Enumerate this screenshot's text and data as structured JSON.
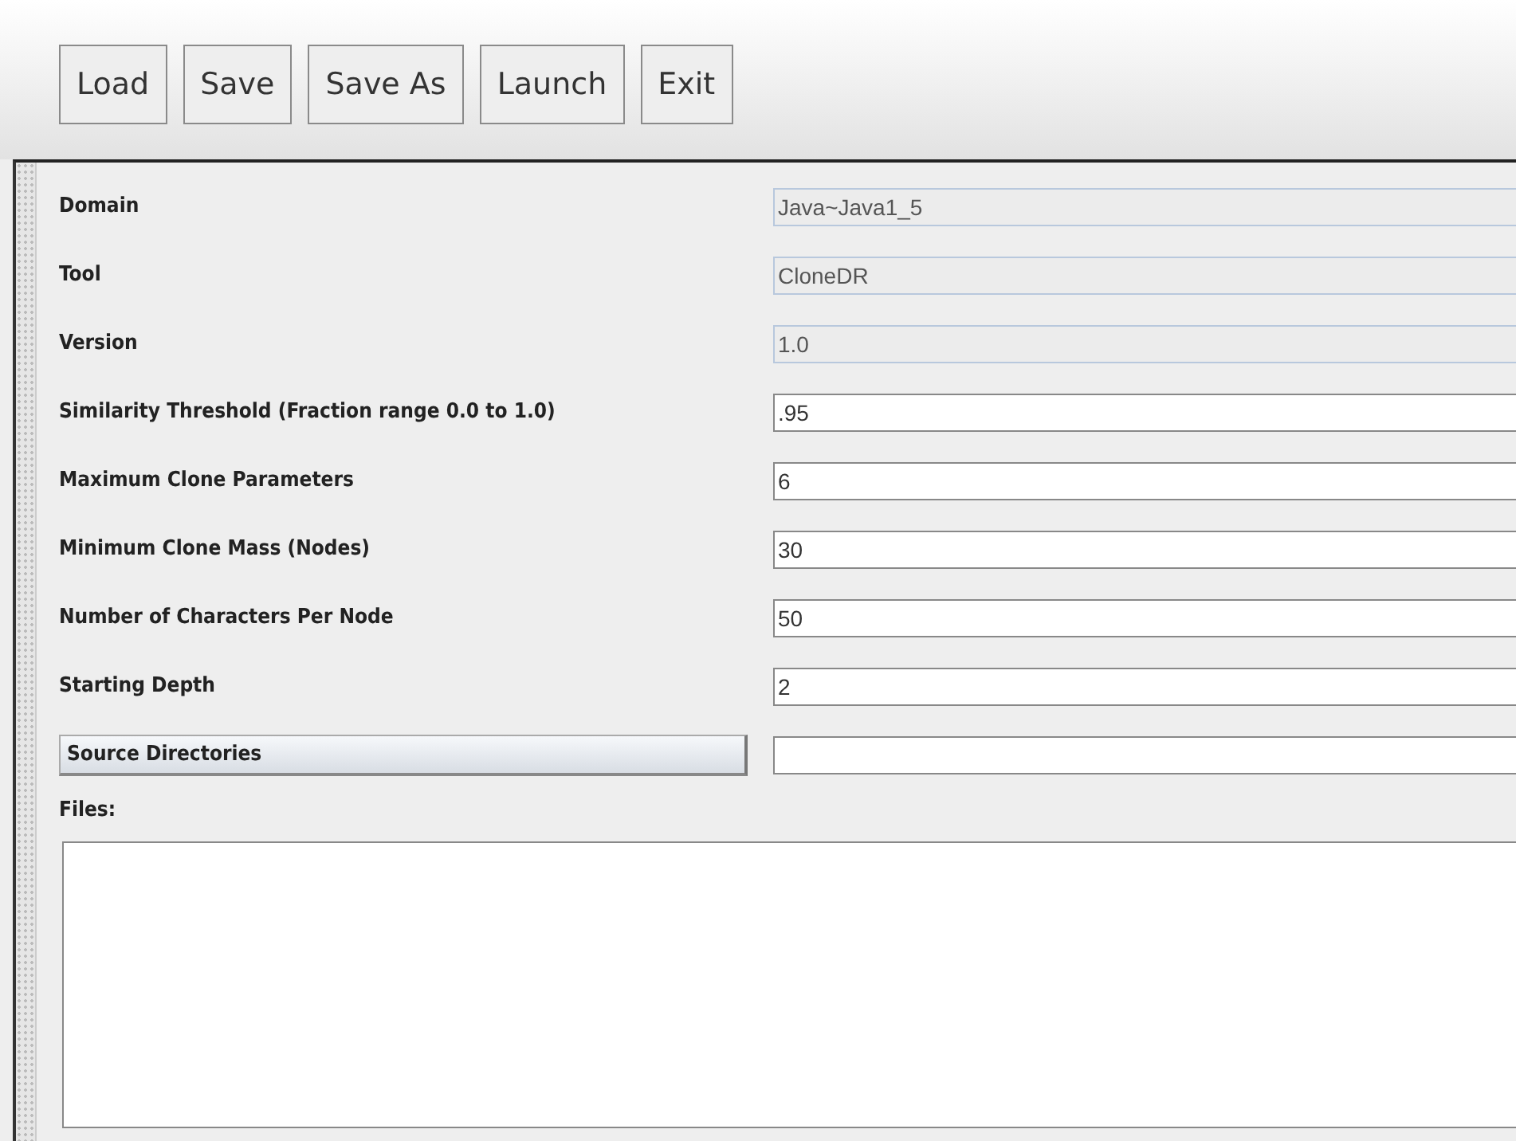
{
  "toolbar": {
    "buttons": [
      "Load",
      "Save",
      "Save As",
      "Launch",
      "Exit"
    ]
  },
  "form": {
    "rows": [
      {
        "kind": "label",
        "label": "Domain",
        "value": "Java~Java1_5",
        "editable": false
      },
      {
        "kind": "label",
        "label": "Tool",
        "value": "CloneDR",
        "editable": false
      },
      {
        "kind": "label",
        "label": "Version",
        "value": "1.0",
        "editable": false
      },
      {
        "kind": "label",
        "label": "Similarity Threshold (Fraction range 0.0 to 1.0)",
        "value": ".95",
        "editable": true
      },
      {
        "kind": "label",
        "label": "Maximum Clone Parameters",
        "value": "6",
        "editable": true
      },
      {
        "kind": "label",
        "label": "Minimum Clone Mass (Nodes)",
        "value": "30",
        "editable": true
      },
      {
        "kind": "label",
        "label": "Number of Characters Per Node",
        "value": "50",
        "editable": true
      },
      {
        "kind": "label",
        "label": "Starting Depth",
        "value": "2",
        "editable": true
      },
      {
        "kind": "button",
        "label": "Source Directories",
        "editable": true
      }
    ],
    "files_label": "Files:"
  }
}
